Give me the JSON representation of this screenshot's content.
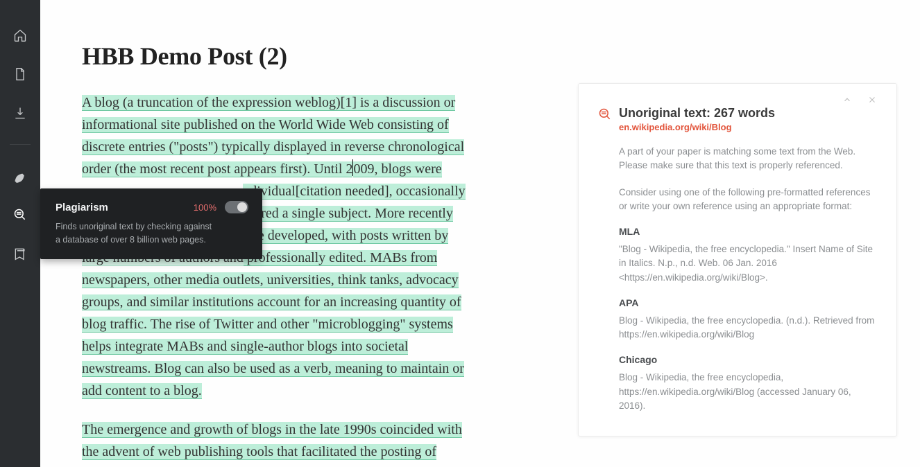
{
  "sidebar": {
    "icons": [
      "home-icon",
      "document-icon",
      "download-icon",
      "pen-icon",
      "search-text-icon",
      "bookmark-icon"
    ]
  },
  "tooltip": {
    "title": "Plagiarism",
    "percentage": "100%",
    "desc_line1": "Finds unoriginal text by checking against",
    "desc_line2": "a database of over 8 billion web pages."
  },
  "post": {
    "title": "HBB Demo Post (2)",
    "p1_a": "A blog (a truncation of the expression weblog)[1] is a discussion or",
    "p1_b": "informational site published on the World Wide Web consisting of",
    "p1_c": "discrete entries (\"posts\") typically displayed in reverse chronological",
    "p1_d": "order (the most recent post appears first). Until 2",
    "p1_e": "009, blogs were",
    "p1_hidden_prefix1": "ndividual[citation needed], occasionally",
    "p1_hidden_prefix2": "vered a single subject. More recently",
    "p1_hidden_prefix3": "ave developed, with posts written by",
    "p1_f_lead": "large numbers of authors and",
    "p1_f": " professionally edited. MABs from",
    "p1_g": "newspapers, other media outlets, universities, think tanks, advocacy",
    "p1_h": "groups, and similar institutions account for an increasing quantity of",
    "p1_i": "blog traffic. The rise of Twitter and other \"microblogging\" systems",
    "p1_j": "helps integrate MABs and single-author blogs into societal",
    "p1_k": "newstreams. Blog can also be used as a verb, meaning to maintain or",
    "p1_l": "add content to a blog.",
    "p2_a": "The emergence and growth of blogs in the late 1990s coincided with",
    "p2_b": "the advent of web publishing tools that facilitated the posting of"
  },
  "panel": {
    "title": "Unoriginal text: 267 words",
    "source": "en.wikipedia.org/wiki/Blog",
    "intro1": "A part of your paper is matching some text from the Web. Please make sure that this text is properly referenced.",
    "intro2": "Consider using one of the following pre-formatted references or write your own reference using an appropriate format:",
    "refs": [
      {
        "label": "MLA",
        "text": "\"Blog - Wikipedia, the free encyclopedia.\" Insert Name of Site in Italics. N.p., n.d. Web. 06 Jan. 2016 <https://en.wikipedia.org/wiki/Blog>."
      },
      {
        "label": "APA",
        "text": "Blog - Wikipedia, the free encyclopedia. (n.d.). Retrieved from https://en.wikipedia.org/wiki/Blog"
      },
      {
        "label": "Chicago",
        "text": "Blog - Wikipedia, the free encyclopedia, https://en.wikipedia.org/wiki/Blog (accessed January 06, 2016)."
      }
    ]
  }
}
